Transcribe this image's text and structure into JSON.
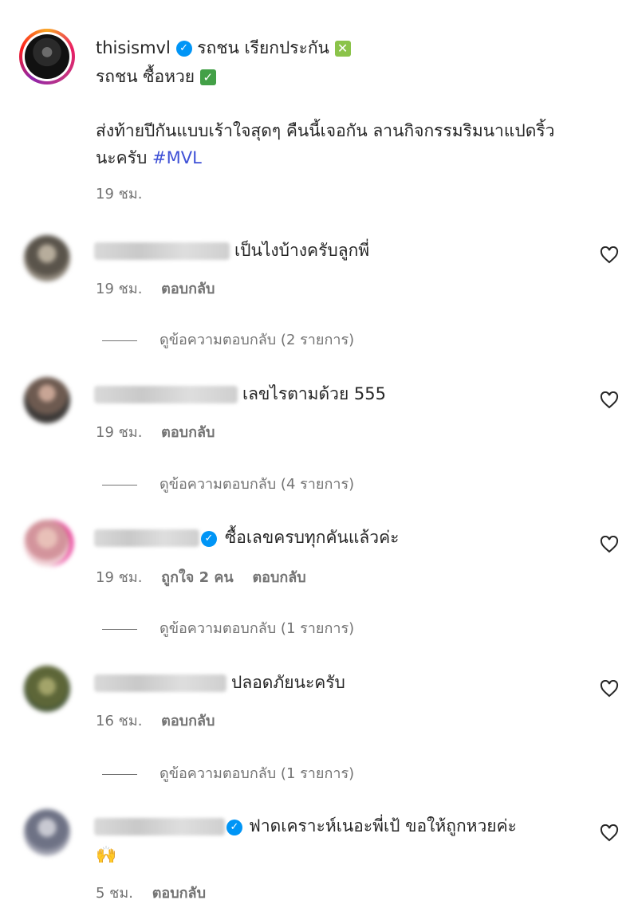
{
  "post": {
    "username": "thisismvl",
    "line1_text": "รถชน เรียกประกัน",
    "line1_emoji": "✕",
    "line2_text": "รถชน ซื้อหวย",
    "line2_emoji": "✓",
    "caption_line1": "ส่งท้ายปีกันแบบเร้าใจสุดๆ คืนนี้เจอกัน ลานกิจกรรมริมนาแปดริ้ว",
    "caption_line2": "นะครับ",
    "hashtag": "#MVL",
    "time": "19 ชม."
  },
  "comments": [
    {
      "text": "เป็นไงบ้างครับลูกพี่",
      "time": "19 ชม.",
      "reply": "ตอบกลับ",
      "view_replies": "ดูข้อความตอบกลับ (2 รายการ)",
      "avatar_color": "#7a7266"
    },
    {
      "text": "เลขไรตามด้วย 555",
      "time": "19 ชม.",
      "reply": "ตอบกลับ",
      "view_replies": "ดูข้อความตอบกลับ (4 รายการ)",
      "avatar_color": "#8a7064"
    },
    {
      "text": "ซื้อเลขครบทุกคันแล้วค่ะ",
      "time": "19 ชม.",
      "likes": "ถูกใจ 2 คน",
      "reply": "ตอบกลับ",
      "view_replies": "ดูข้อความตอบกลับ (1 รายการ)",
      "avatar_color": "#d9a5a8"
    },
    {
      "text": "ปลอดภัยนะครับ",
      "time": "16 ชม.",
      "reply": "ตอบกลับ",
      "view_replies": "ดูข้อความตอบกลับ (1 รายการ)",
      "avatar_color": "#6e7752"
    },
    {
      "text": "ฟาดเคราะห์เนอะพี่เป้ ขอให้ถูกหวยค่ะ",
      "emoji": "🙌",
      "time": "5 ชม.",
      "reply": "ตอบกลับ",
      "avatar_color": "#8c8f9c"
    }
  ],
  "colors": {
    "verified": "#0095f6",
    "hashtag": "#3f51d6",
    "meta": "#737373"
  },
  "icons": {
    "heart": "heart-icon",
    "verified": "verified-badge-icon"
  }
}
